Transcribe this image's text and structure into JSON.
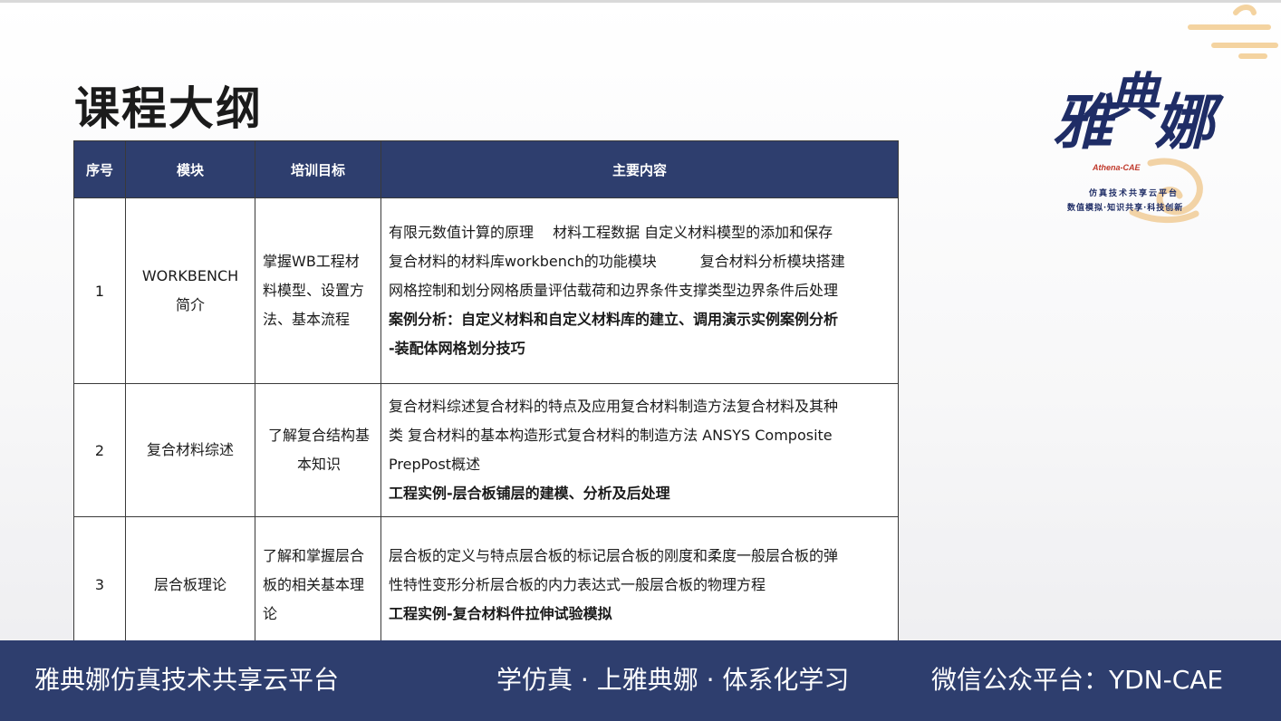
{
  "page": {
    "title": "课程大纲"
  },
  "logo": {
    "chars": [
      "雅",
      "典",
      "娜"
    ],
    "en": "Athena-CAE",
    "tagline1": "仿真技术共享云平台",
    "tagline2": "数值模拟·知识共享·科技创新"
  },
  "table": {
    "headers": [
      "序号",
      "模块",
      "培训目标",
      "主要内容"
    ],
    "rows": [
      {
        "index": "1",
        "module": [
          "WORKBENCH",
          "简介"
        ],
        "goal": [
          "掌握WB工程材",
          "料模型、设置方",
          "法、基本流程"
        ],
        "content": [
          "有限元数值计算的原理　 材料工程数据  自定义材料模型的添加和保存",
          "复合材料的材料库workbench的功能模块　　　复合材料分析模块搭建",
          "网格控制和划分网格质量评估载荷和边界条件支撑类型边界条件后处理"
        ],
        "case": [
          "案例分析：自定义材料和自定义材料库的建立、调用演示实例案例分析",
          "-装配体网格划分技巧"
        ]
      },
      {
        "index": "2",
        "module": [
          "复合材料综述"
        ],
        "goal": [
          "了解复合结构基",
          "本知识"
        ],
        "content": [
          "复合材料综述复合材料的特点及应用复合材料制造方法复合材料及其种",
          "类 复合材料的基本构造形式复合材料的制造方法 ANSYS Composite",
          "PrepPost概述"
        ],
        "case": [
          "工程实例-层合板铺层的建模、分析及后处理"
        ]
      },
      {
        "index": "3",
        "module": [
          "层合板理论"
        ],
        "goal": [
          "了解和掌握层合",
          "板的相关基本理",
          "论"
        ],
        "content": [
          "层合板的定义与特点层合板的标记层合板的刚度和柔度一般层合板的弹",
          "性特性变形分析层合板的内力表达式一般层合板的物理方程"
        ],
        "case": [
          "工程实例-复合材料件拉伸试验模拟"
        ]
      }
    ]
  },
  "footer": {
    "left": "雅典娜仿真技术共享云平台",
    "middle": "学仿真 · 上雅典娜 · 体系化学习",
    "right": "微信公众平台：YDN-CAE"
  },
  "colors": {
    "navy": "#2e3e6e",
    "logo_blue": "#1f2d66",
    "logo_accent": "#c0392b",
    "deco_gold": "#f2c98a"
  }
}
